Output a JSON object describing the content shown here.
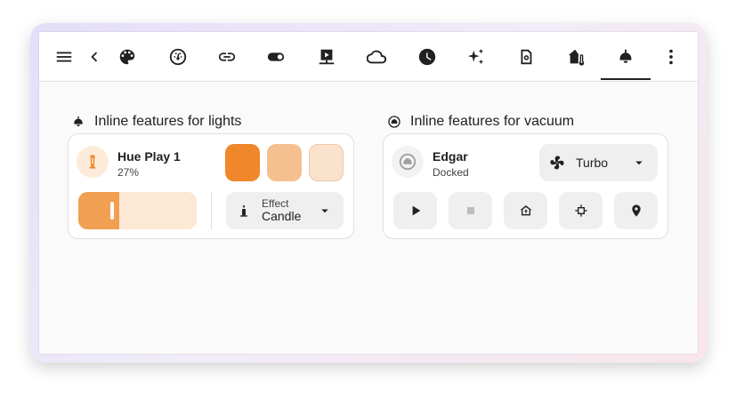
{
  "toolbar": {
    "icons": [
      "menu-icon",
      "back-icon",
      "palette-icon",
      "gauge-icon",
      "link-icon",
      "toggle-icon",
      "media-icon",
      "cloud-icon",
      "clock-icon",
      "sparkles-icon",
      "robot-vacuum-icon",
      "home-thermometer-icon",
      "ceiling-light-icon",
      "more-vertical-icon"
    ],
    "active_tab": "ceiling-light-icon"
  },
  "lights": {
    "section_title": "Inline features for lights",
    "entity_name": "Hue Play 1",
    "entity_state": "27%",
    "brightness_percent": 27,
    "swatch_colors": [
      "#f0872a",
      "#f5c08f",
      "#fbe2cc"
    ],
    "effect_label": "Effect",
    "effect_value": "Candle",
    "accent_color": "#f0a050"
  },
  "vacuum": {
    "section_title": "Inline features for vacuum",
    "entity_name": "Edgar",
    "entity_state": "Docked",
    "fan_speed": "Turbo",
    "actions": [
      "play-icon",
      "stop-icon",
      "return-home-icon",
      "clean-spot-icon",
      "locate-icon"
    ]
  }
}
